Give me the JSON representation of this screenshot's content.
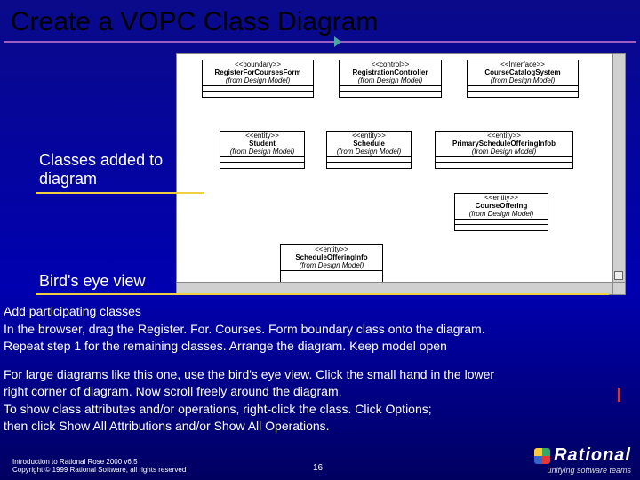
{
  "title": "Create a VOPC Class Diagram",
  "annotations": {
    "a1": "Classes added to diagram",
    "a2": "Bird's eye view"
  },
  "classes": [
    {
      "id": "c0",
      "stereo": "<<boundary>>",
      "name": "RegisterForCoursesForm",
      "from": "(from Design Model)"
    },
    {
      "id": "c1",
      "stereo": "<<control>>",
      "name": "RegistrationController",
      "from": "(from Design Model)"
    },
    {
      "id": "c2",
      "stereo": "<<Interface>>",
      "name": "CourseCatalogSystem",
      "from": "(from Design Model)"
    },
    {
      "id": "c3",
      "stereo": "<<entity>>",
      "name": "Student",
      "from": "(from Design Model)"
    },
    {
      "id": "c4",
      "stereo": "<<entity>>",
      "name": "Schedule",
      "from": "(from Design Model)"
    },
    {
      "id": "c5",
      "stereo": "<<entity>>",
      "name": "PrimaryScheduleOfferingInfob",
      "from": "(from Design Model)"
    },
    {
      "id": "c6",
      "stereo": "<<entity>>",
      "name": "CourseOffering",
      "from": "(from Design Model)"
    },
    {
      "id": "c7",
      "stereo": "<<entity>>",
      "name": "ScheduleOfferingInfo",
      "from": "(from Design Model)"
    }
  ],
  "body": {
    "p1": "Add participating classes",
    "p2": "In the browser, drag the Register. For. Courses. Form boundary class onto the diagram.",
    "p3": "Repeat step 1 for the remaining classes.  Arrange the diagram.  Keep model open",
    "p4": "For large diagrams like this one, use the bird's eye view. Click the small hand in the lower",
    "p5": " right corner of diagram. Now scroll freely around the diagram.",
    "p6": "To show class attributes and/or operations, right-click the class. Click Options;",
    "p7": "then click Show All Attributions and/or Show All Operations."
  },
  "footer": {
    "l1": "Introduction to Rational Rose 2000 v6.5",
    "l2": "Copyright © 1999 Rational Software, all rights reserved"
  },
  "page": "16",
  "brand": {
    "name": "Rational",
    "tag": "unifying software teams"
  }
}
